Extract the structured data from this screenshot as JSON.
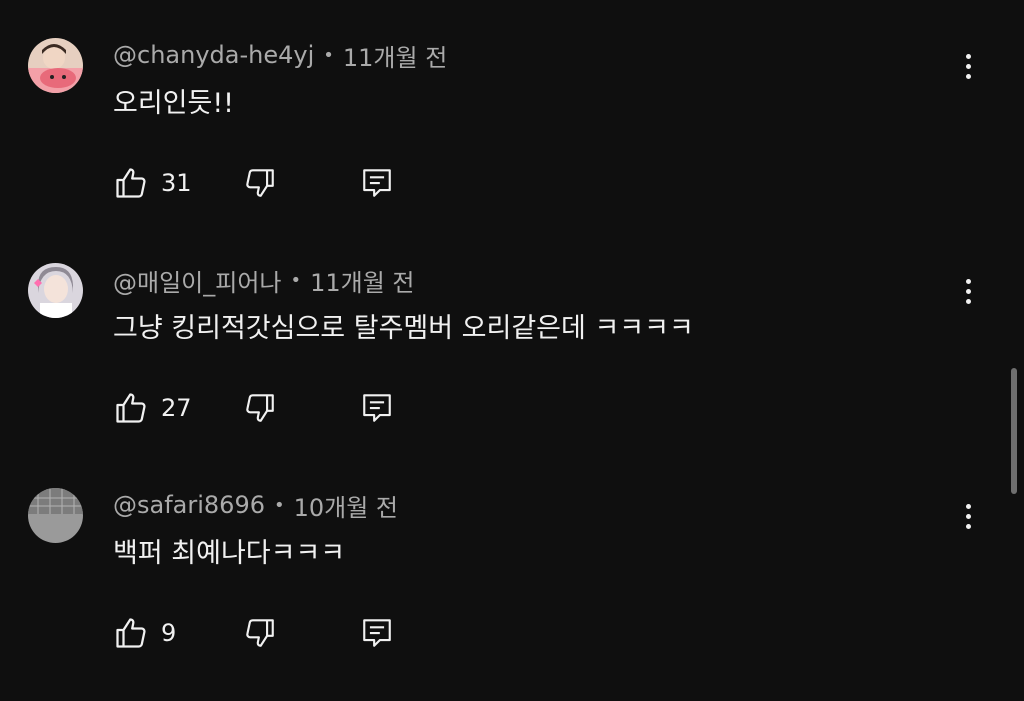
{
  "comments": [
    {
      "author": "@chanyda-he4yj",
      "separator": "•",
      "time": "11개월 전",
      "text": "오리인듯!!",
      "likes": "31",
      "avatar_icon": "photo-avatar-icon",
      "avatar_bg": "#d9b8a0"
    },
    {
      "author": "@매일이_피어나",
      "separator": "•",
      "time": "11개월 전",
      "text": "그냥 킹리적갓심으로 탈주멤버 오리같은데 ㅋㅋㅋㅋ",
      "likes": "27",
      "avatar_icon": "photo-avatar-icon",
      "avatar_bg": "#c9c7cf"
    },
    {
      "author": "@safari8696",
      "separator": "•",
      "time": "10개월 전",
      "text": "백퍼 최예나다ㅋㅋㅋ",
      "likes": "9",
      "avatar_icon": "photo-avatar-icon",
      "avatar_bg": "#8a8a8a"
    }
  ],
  "icons": {
    "like": "thumbs-up-icon",
    "dislike": "thumbs-down-icon",
    "reply": "reply-icon",
    "more": "more-vertical-icon"
  },
  "colors": {
    "background": "#0f0f0f",
    "text_primary": "#f1f1f1",
    "text_secondary": "#aaaaaa",
    "scrollbar": "#6f6f6f"
  }
}
